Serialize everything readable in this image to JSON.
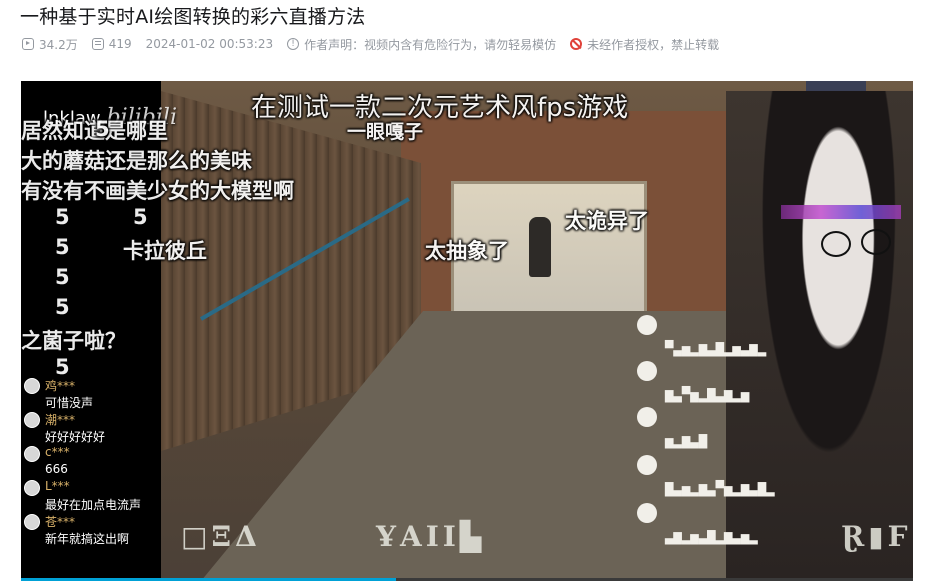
{
  "video": {
    "title": "一种基于实时AI绘图转换的彩六直播方法",
    "views": "34.2万",
    "danmaku_count": "419",
    "publish_time": "2024-01-02 00:53:23",
    "author_statement": "作者声明：视频内含有危险行为，请勿轻易模仿",
    "repost_notice": "未经作者授权，禁止转载",
    "progress_fraction": 0.42
  },
  "icons": {
    "views": "play-count-icon",
    "danmaku": "danmaku-count-icon",
    "statement": "info-circle-icon",
    "repost": "no-repost-icon"
  },
  "colors": {
    "meta_text": "#9499a0",
    "title_text": "#18191c",
    "warning": "#e0423a",
    "chat_username": "#d9b26a",
    "progress": "#00a1d6"
  },
  "player": {
    "watermark_user": "lnklaw",
    "watermark_logo": "bilibili",
    "subtitle": "在测试一款二次元艺术风fps游戏",
    "danmaku": [
      "居然知道是哪里",
      "大的蘑菇还是那么的美味",
      "有没有不画美少女的大模型啊",
      "5",
      "5",
      "5",
      "5",
      "5",
      "5",
      "5",
      "卡拉彼丘",
      "一眼嘎子",
      "太抽象了",
      "太诡异了",
      "之菌子啦？"
    ],
    "chat": [
      {
        "user": "鸡***",
        "text": "可惜没声"
      },
      {
        "user": "潮***",
        "text": "好好好好好"
      },
      {
        "user": "c***",
        "text": "666"
      },
      {
        "user": "L***",
        "text": "最好在加点电流声"
      },
      {
        "user": "苍***",
        "text": "新年就搞这出啊"
      }
    ]
  }
}
